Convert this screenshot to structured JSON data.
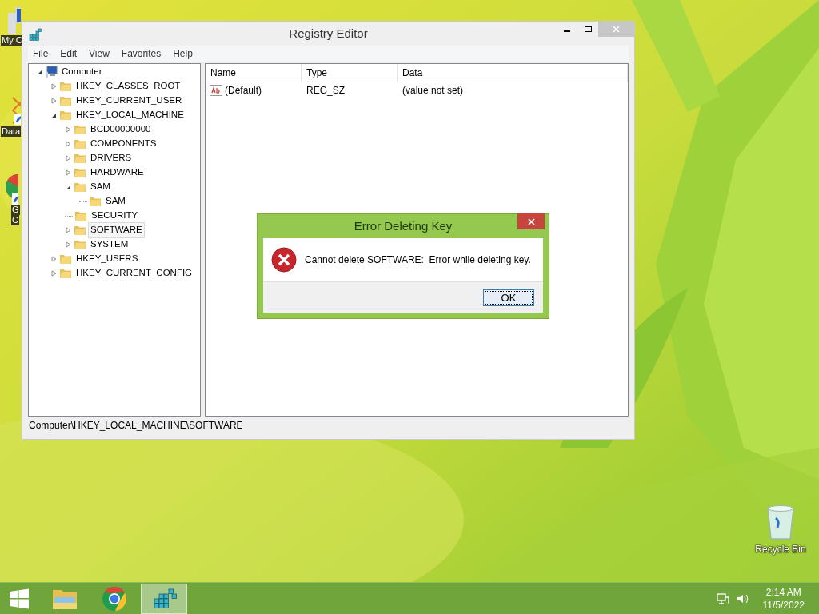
{
  "desktop": {
    "icons": [
      {
        "kind": "computer",
        "lines": [
          "My C"
        ]
      },
      {
        "kind": "shortcut",
        "lines": [
          "Data"
        ]
      },
      {
        "kind": "chrome",
        "lines": [
          "G",
          "C"
        ]
      }
    ],
    "recycle_bin": {
      "label": "Recycle Bin"
    }
  },
  "registry_editor": {
    "title": "Registry Editor",
    "menu": [
      "File",
      "Edit",
      "View",
      "Favorites",
      "Help"
    ],
    "tree": [
      {
        "label": "Computer",
        "kind": "computer",
        "expandable": true,
        "expanded": true,
        "selected": false,
        "children": [
          {
            "label": "HKEY_CLASSES_ROOT",
            "kind": "folder",
            "expandable": true,
            "expanded": false,
            "selected": false
          },
          {
            "label": "HKEY_CURRENT_USER",
            "kind": "folder",
            "expandable": true,
            "expanded": false,
            "selected": false
          },
          {
            "label": "HKEY_LOCAL_MACHINE",
            "kind": "folder",
            "expandable": true,
            "expanded": true,
            "selected": false,
            "children": [
              {
                "label": "BCD00000000",
                "kind": "folder",
                "expandable": true,
                "expanded": false,
                "selected": false
              },
              {
                "label": "COMPONENTS",
                "kind": "folder",
                "expandable": true,
                "expanded": false,
                "selected": false
              },
              {
                "label": "DRIVERS",
                "kind": "folder",
                "expandable": true,
                "expanded": false,
                "selected": false
              },
              {
                "label": "HARDWARE",
                "kind": "folder",
                "expandable": true,
                "expanded": false,
                "selected": false
              },
              {
                "label": "SAM",
                "kind": "folder",
                "expandable": true,
                "expanded": true,
                "selected": false,
                "children": [
                  {
                    "label": "SAM",
                    "kind": "folder",
                    "expandable": false,
                    "expanded": false,
                    "selected": false
                  }
                ]
              },
              {
                "label": "SECURITY",
                "kind": "folder",
                "expandable": false,
                "expanded": false,
                "selected": false
              },
              {
                "label": "SOFTWARE",
                "kind": "folder",
                "expandable": true,
                "expanded": false,
                "selected": true
              },
              {
                "label": "SYSTEM",
                "kind": "folder",
                "expandable": true,
                "expanded": false,
                "selected": false
              }
            ]
          },
          {
            "label": "HKEY_USERS",
            "kind": "folder",
            "expandable": true,
            "expanded": false,
            "selected": false
          },
          {
            "label": "HKEY_CURRENT_CONFIG",
            "kind": "folder",
            "expandable": true,
            "expanded": false,
            "selected": false
          }
        ]
      }
    ],
    "columns": [
      "Name",
      "Type",
      "Data"
    ],
    "rows": [
      {
        "name": "(Default)",
        "type": "REG_SZ",
        "data": "(value not set)"
      }
    ],
    "status_bar": "Computer\\HKEY_LOCAL_MACHINE\\SOFTWARE"
  },
  "dialog": {
    "title": "Error Deleting Key",
    "message": "Cannot delete SOFTWARE:  Error while deleting key.",
    "button": "OK"
  },
  "taskbar": {
    "apps": [
      {
        "kind": "explorer",
        "selected": false
      },
      {
        "kind": "chrome",
        "selected": false
      },
      {
        "kind": "regedit",
        "selected": true
      }
    ],
    "time": "2:14 AM",
    "date": "11/5/2022"
  }
}
